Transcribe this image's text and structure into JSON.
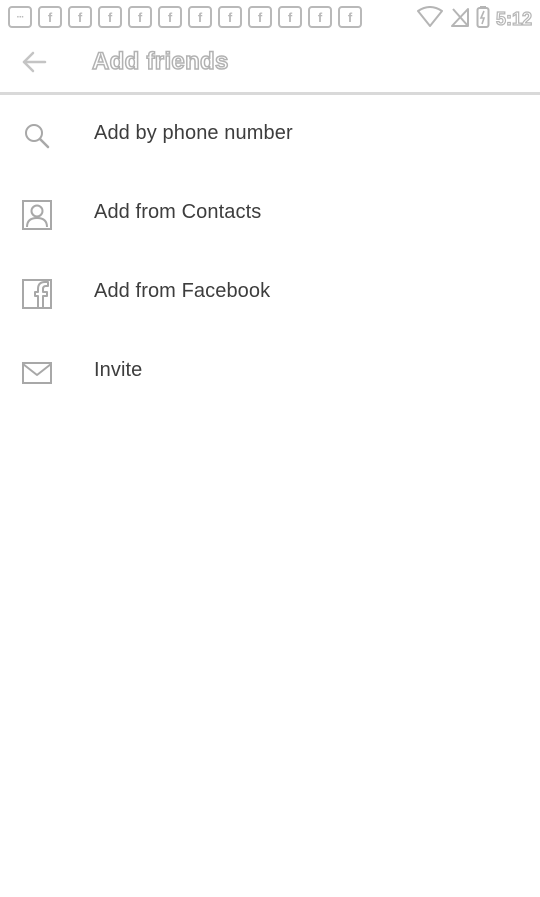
{
  "status_bar": {
    "time": "5:12",
    "notification_icons": [
      "message-icon",
      "facebook-icon",
      "facebook-icon",
      "facebook-icon",
      "facebook-icon",
      "facebook-icon",
      "facebook-icon",
      "facebook-icon",
      "facebook-icon",
      "facebook-icon",
      "facebook-icon",
      "facebook-icon"
    ]
  },
  "app_bar": {
    "title": "Add friends",
    "back_icon": "arrow-left-icon"
  },
  "menu": {
    "items": [
      {
        "label": "Add by phone number",
        "icon": "search-icon"
      },
      {
        "label": "Add from Contacts",
        "icon": "contact-icon"
      },
      {
        "label": "Add from Facebook",
        "icon": "facebook-icon"
      },
      {
        "label": "Invite",
        "icon": "mail-icon"
      }
    ]
  },
  "colors": {
    "background": "#ffffff",
    "text": "#3d3d3d",
    "icon": "#a8a8a8",
    "divider": "#d9d9d9"
  }
}
